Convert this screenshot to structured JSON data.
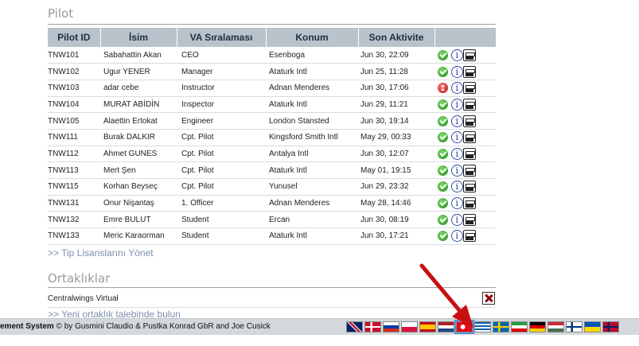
{
  "pilot_section": {
    "title": "Pilot",
    "columns": [
      "Pilot ID",
      "İsim",
      "VA Sıralaması",
      "Konum",
      "Son Aktivite",
      ""
    ],
    "rows": [
      {
        "id": "TNW101",
        "name": "Sabahattin Akan",
        "rank": "CEO",
        "location": "Esenboga",
        "activity": "Jun 30, 22:09",
        "status": "online"
      },
      {
        "id": "TNW102",
        "name": "Ugur YENER",
        "rank": "Manager",
        "location": "Ataturk Intl",
        "activity": "Jun 25, 11:28",
        "status": "online"
      },
      {
        "id": "TNW103",
        "name": "adar cebe",
        "rank": "Instructor",
        "location": "Adnan Menderes",
        "activity": "Jun 30, 17:06",
        "status": "offline"
      },
      {
        "id": "TNW104",
        "name": "MURAT ABİDİN",
        "rank": "Inspector",
        "location": "Ataturk Intl",
        "activity": "Jun 29, 11:21",
        "status": "online"
      },
      {
        "id": "TNW105",
        "name": "Alaettin Ertokat",
        "rank": "Engineer",
        "location": "London Stansted",
        "activity": "Jun 30, 19:14",
        "status": "online"
      },
      {
        "id": "TNW111",
        "name": "Burak DALKIR",
        "rank": "Cpt. Pilot",
        "location": "Kingsford Smith Intl",
        "activity": "May 29, 00:33",
        "status": "online"
      },
      {
        "id": "TNW112",
        "name": "Ahmet GUNES",
        "rank": "Cpt. Pilot",
        "location": "Antalya Intl",
        "activity": "Jun 30, 12:07",
        "status": "online"
      },
      {
        "id": "TNW113",
        "name": "Mert Şen",
        "rank": "Cpt. Pilot",
        "location": "Ataturk Intl",
        "activity": "May 01, 19:15",
        "status": "online"
      },
      {
        "id": "TNW115",
        "name": "Korhan Beyseç",
        "rank": "Cpt. Pilot",
        "location": "Yunusel",
        "activity": "Jun 29, 23:32",
        "status": "online"
      },
      {
        "id": "TNW131",
        "name": "Onur Nişantaş",
        "rank": "1. Officer",
        "location": "Adnan Menderes",
        "activity": "May 28, 14:46",
        "status": "online"
      },
      {
        "id": "TNW132",
        "name": "Emre BULUT",
        "rank": "Student",
        "location": "Ercan",
        "activity": "Jun 30, 08:19",
        "status": "online"
      },
      {
        "id": "TNW133",
        "name": "Meric Karaorman",
        "rank": "Student",
        "location": "Ataturk Intl",
        "activity": "Jun 30, 17:21",
        "status": "online"
      }
    ],
    "info_icon_glyph": "i",
    "manage_link": ">> Tip Lisanslarını Yönet"
  },
  "partners_section": {
    "title": "Ortaklıklar",
    "partners": [
      {
        "name": "Centralwings Virtual"
      }
    ],
    "request_link": ">> Yeni ortaklık talebinde bulun"
  },
  "footer": {
    "system_name": "ement System",
    "credit": " © by Gusmini Claudio & Pustka Konrad GbR and Joe Cusick",
    "flags": [
      "en",
      "da",
      "ru",
      "pl",
      "es",
      "nl",
      "tr",
      "gr",
      "se",
      "ir",
      "de",
      "hu",
      "fi",
      "ua",
      "no"
    ],
    "selected_flag": "tr"
  },
  "colors": {
    "header_bg": "#b9c3cb",
    "link": "#7d8fb0",
    "footer_bg": "#d3d8dc",
    "arrow": "#c81010"
  }
}
